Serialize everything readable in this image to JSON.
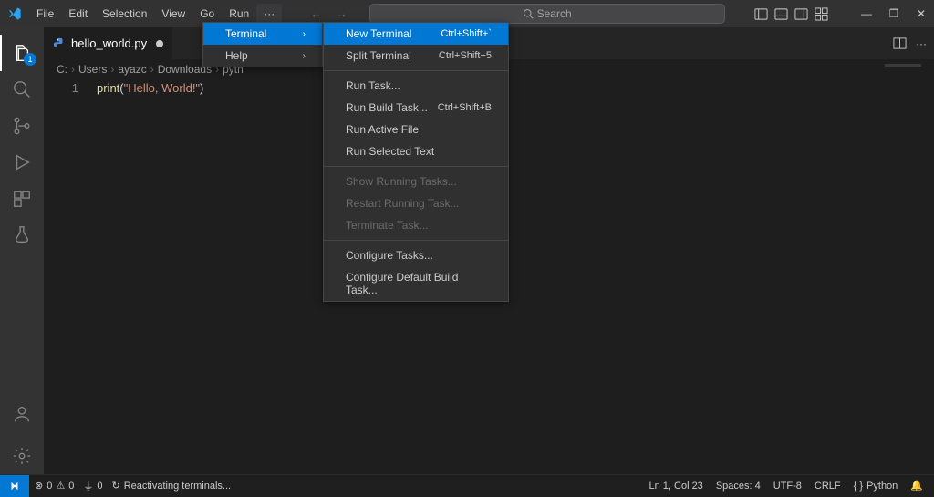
{
  "menubar": {
    "items": [
      "File",
      "Edit",
      "Selection",
      "View",
      "Go",
      "Run"
    ]
  },
  "search": {
    "placeholder": "Search"
  },
  "overflow_menu": {
    "items": [
      {
        "label": "Terminal",
        "highlight": true,
        "submenu": true
      },
      {
        "label": "Help",
        "submenu": true
      }
    ]
  },
  "terminal_menu": {
    "groups": [
      [
        {
          "label": "New Terminal",
          "shortcut": "Ctrl+Shift+`",
          "highlight": true
        },
        {
          "label": "Split Terminal",
          "shortcut": "Ctrl+Shift+5"
        }
      ],
      [
        {
          "label": "Run Task..."
        },
        {
          "label": "Run Build Task...",
          "shortcut": "Ctrl+Shift+B"
        },
        {
          "label": "Run Active File"
        },
        {
          "label": "Run Selected Text"
        }
      ],
      [
        {
          "label": "Show Running Tasks...",
          "disabled": true
        },
        {
          "label": "Restart Running Task...",
          "disabled": true
        },
        {
          "label": "Terminate Task...",
          "disabled": true
        }
      ],
      [
        {
          "label": "Configure Tasks..."
        },
        {
          "label": "Configure Default Build Task..."
        }
      ]
    ]
  },
  "activitybar": {
    "explorer_badge": "1"
  },
  "tab": {
    "name": "hello_world.py"
  },
  "breadcrumbs": {
    "parts": [
      "C:",
      "Users",
      "ayazc",
      "Downloads",
      "pyth"
    ]
  },
  "code": {
    "line_no": "1",
    "fn": "print",
    "open": "(",
    "str": "\"Hello, World!\"",
    "close": ")"
  },
  "status": {
    "errors": "0",
    "warnings": "0",
    "ports": "0",
    "activity": "Reactivating terminals...",
    "cursor": "Ln 1, Col 23",
    "spaces": "Spaces: 4",
    "encoding": "UTF-8",
    "eol": "CRLF",
    "lang": "Python"
  }
}
